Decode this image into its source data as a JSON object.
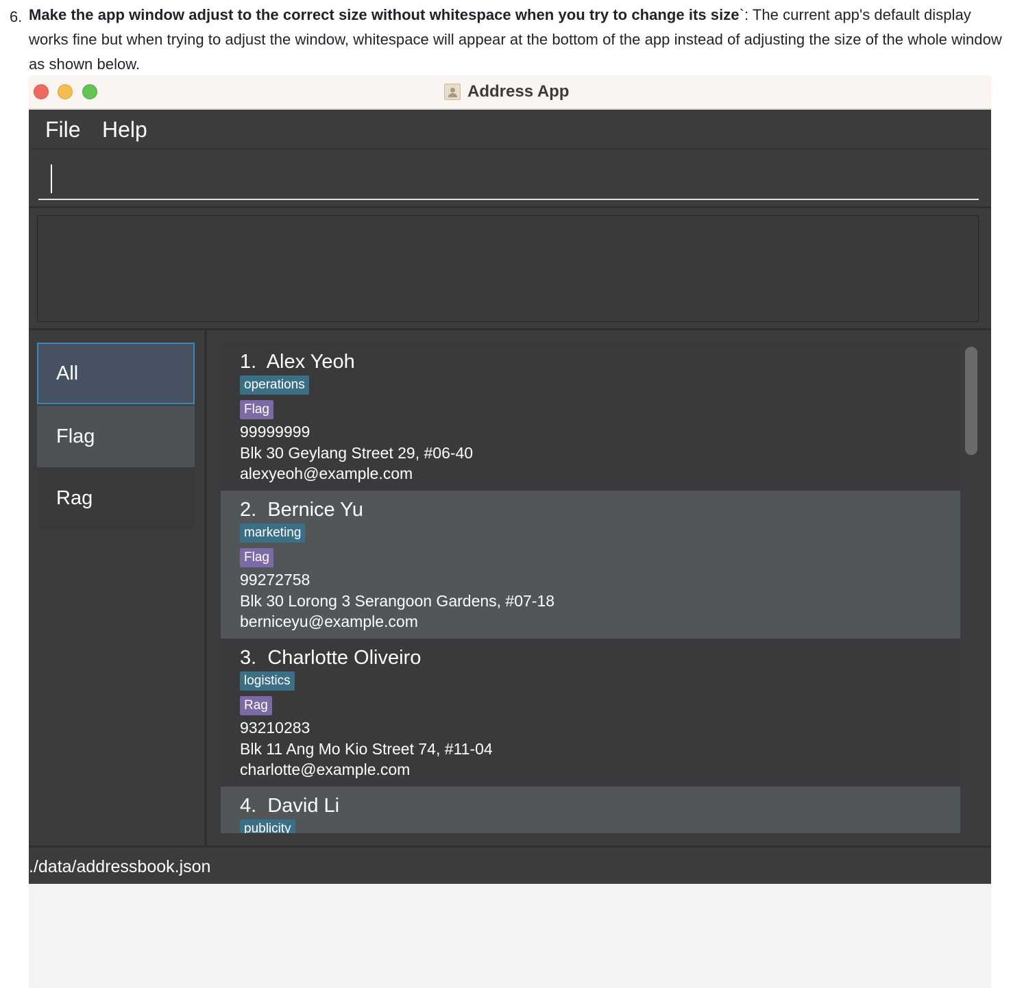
{
  "doc": {
    "number": "6.",
    "bold": "Make the app window adjust to the correct size without whitespace when you try to change its size",
    "backtick": "`",
    "rest": ": The current app's default display works fine but when trying to adjust the window, whitespace will appear at the bottom of the app instead of adjusting the size of the whole window as shown below."
  },
  "window": {
    "title": "Address App",
    "icon": "address-book-icon"
  },
  "menu": {
    "file": "File",
    "help": "Help"
  },
  "command": {
    "value": "",
    "placeholder": ""
  },
  "result": {
    "text": ""
  },
  "sidebar": {
    "items": [
      {
        "label": "All",
        "selected": true
      },
      {
        "label": "Flag",
        "selected": false
      },
      {
        "label": "Rag",
        "selected": false
      }
    ]
  },
  "persons": [
    {
      "index": "1.",
      "name": "Alex Yeoh",
      "tag": "operations",
      "label": "Flag",
      "phone": "99999999",
      "address": "Blk 30 Geylang Street 29, #06-40",
      "email": "alexyeoh@example.com"
    },
    {
      "index": "2.",
      "name": "Bernice Yu",
      "tag": "marketing",
      "label": "Flag",
      "phone": "99272758",
      "address": "Blk 30 Lorong 3 Serangoon Gardens, #07-18",
      "email": "berniceyu@example.com"
    },
    {
      "index": "3.",
      "name": "Charlotte Oliveiro",
      "tag": "logistics",
      "label": "Rag",
      "phone": "93210283",
      "address": "Blk 11 Ang Mo Kio Street 74, #11-04",
      "email": "charlotte@example.com"
    },
    {
      "index": "4.",
      "name": "David Li",
      "tag": "publicity",
      "label": "",
      "phone": "",
      "address": "",
      "email": ""
    }
  ],
  "status": {
    "path": "./data/addressbook.json"
  },
  "colors": {
    "close": "#ee6a5e",
    "minimize": "#f5bd4f",
    "maximize": "#61c455",
    "dept_tag": "#3a6f85",
    "label_tag": "#7b6aa6",
    "selected_border": "#3d88b5"
  }
}
